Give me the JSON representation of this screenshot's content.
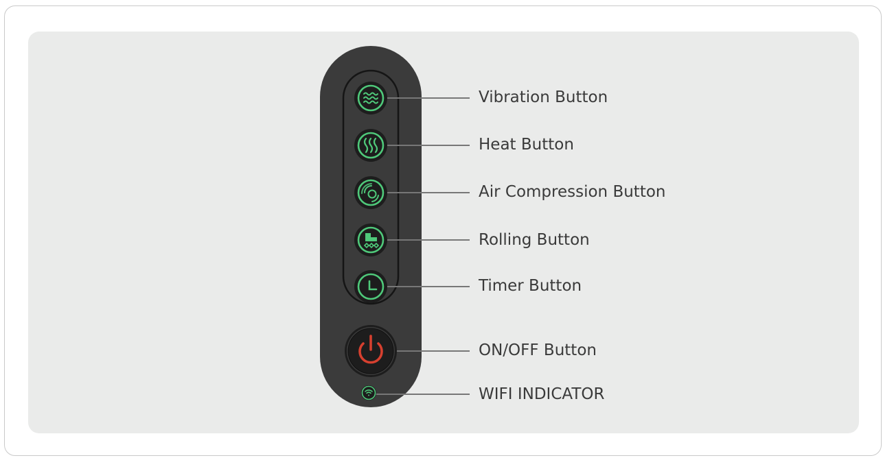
{
  "colors": {
    "remote_body": "#3b3b3b",
    "button_ring": "#1d1d1d",
    "icon_active": "#4fc97a",
    "power_icon": "#d6402f",
    "leader_line": "#777777",
    "label_text": "#3a3a3a"
  },
  "remote": {
    "buttons": [
      {
        "name": "vibration",
        "label": "Vibration Button",
        "icon": "wave-icon"
      },
      {
        "name": "heat",
        "label": "Heat Button",
        "icon": "heat-icon"
      },
      {
        "name": "air-compression",
        "label": "Air Compression Button",
        "icon": "air-compression-icon"
      },
      {
        "name": "rolling",
        "label": "Rolling Button",
        "icon": "roller-icon"
      },
      {
        "name": "timer",
        "label": "Timer Button",
        "icon": "clock-icon"
      },
      {
        "name": "power",
        "label": "ON/OFF Button",
        "icon": "power-icon"
      }
    ],
    "indicator": {
      "name": "wifi",
      "label": "WIFI INDICATOR",
      "icon": "wifi-icon"
    }
  }
}
